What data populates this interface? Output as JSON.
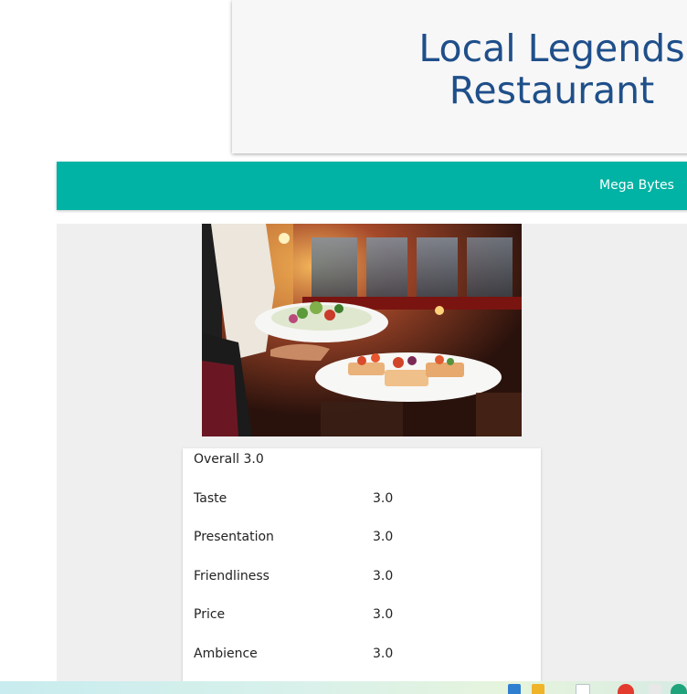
{
  "header": {
    "title_line1": "Local Legends",
    "title_line2": "Restaurant"
  },
  "nav": {
    "link_label": "Mega Bytes"
  },
  "ratings": {
    "overall_label": "Overall 3.0",
    "rows": [
      {
        "label": "Taste",
        "value": "3.0"
      },
      {
        "label": "Presentation",
        "value": "3.0"
      },
      {
        "label": "Friendliness",
        "value": "3.0"
      },
      {
        "label": "Price",
        "value": "3.0"
      },
      {
        "label": "Ambience",
        "value": "3.0"
      }
    ]
  },
  "colors": {
    "title": "#1f4f8a",
    "navbar": "#00b3a4",
    "content_bg": "#efefef"
  },
  "photo": {
    "icon": "restaurant-photo"
  }
}
